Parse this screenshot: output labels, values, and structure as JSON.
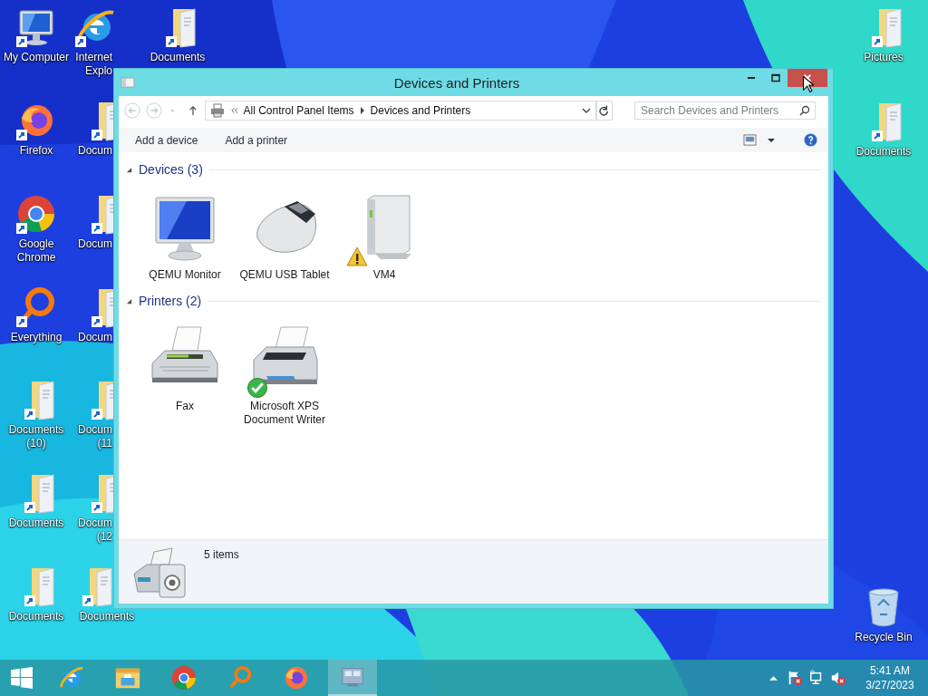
{
  "desktop": {
    "left_columns": [
      {
        "items": [
          {
            "label": "My Computer",
            "kind": "computer"
          },
          {
            "label": "Firefox",
            "kind": "firefox"
          },
          {
            "label": "Google Chrome",
            "kind": "chrome"
          },
          {
            "label": "Everything",
            "kind": "everything"
          },
          {
            "label": "Documents (10)",
            "kind": "folder"
          },
          {
            "label": "Documents",
            "kind": "folder"
          },
          {
            "label": "Documents",
            "kind": "folder"
          }
        ]
      },
      {
        "items": [
          {
            "label": "Internet Explo",
            "kind": "ie",
            "cut": true
          },
          {
            "label": "Docum",
            "kind": "folder",
            "cut": true
          },
          {
            "label": "Docum",
            "kind": "folder",
            "cut": true
          },
          {
            "label": "Docum",
            "kind": "folder",
            "cut": true
          },
          {
            "label": "Docum (11",
            "kind": "folder",
            "cut": true
          },
          {
            "label": "Docum (12",
            "kind": "folder",
            "cut": true
          },
          {
            "label": "Documents",
            "kind": "folder",
            "cut": false
          }
        ]
      },
      {
        "items": [
          {
            "label": "Documents",
            "kind": "folder"
          }
        ]
      }
    ],
    "right_column": {
      "items": [
        {
          "label": "Pictures",
          "kind": "folder"
        },
        {
          "label": "Documents",
          "kind": "folder"
        },
        {
          "label": "Recycle Bin",
          "kind": "recycle"
        }
      ]
    }
  },
  "window": {
    "title": "Devices and Printers",
    "address": {
      "crumbs": [
        "All Control Panel Items",
        "Devices and Printers"
      ]
    },
    "search": {
      "placeholder": "Search Devices and Printers"
    },
    "commands": [
      "Add a device",
      "Add a printer"
    ],
    "groups": [
      {
        "title": "Devices (3)",
        "expanded": true,
        "items": [
          {
            "label": "QEMU Monitor",
            "kind": "monitor",
            "warning": false,
            "default": false
          },
          {
            "label": "QEMU USB Tablet",
            "kind": "mouse",
            "warning": false,
            "default": false
          },
          {
            "label": "VM4",
            "kind": "drive",
            "warning": true,
            "default": false
          }
        ]
      },
      {
        "title": "Printers (2)",
        "expanded": true,
        "items": [
          {
            "label": "Fax",
            "kind": "fax",
            "warning": false,
            "default": false
          },
          {
            "label": "Microsoft XPS Document Writer",
            "kind": "printer",
            "warning": false,
            "default": true
          }
        ]
      }
    ],
    "details": {
      "text": "5 items"
    }
  },
  "taskbar": {
    "items": [
      {
        "kind": "ie",
        "selected": false
      },
      {
        "kind": "explorer",
        "selected": false
      },
      {
        "kind": "chrome",
        "selected": false
      },
      {
        "kind": "everything",
        "selected": false
      },
      {
        "kind": "firefox",
        "selected": false
      },
      {
        "kind": "control-panel",
        "selected": true
      }
    ],
    "tray": [
      {
        "kind": "flag",
        "error": true
      },
      {
        "kind": "network",
        "error": false
      },
      {
        "kind": "volume",
        "error": true
      }
    ],
    "time": "5:41 AM",
    "date": "3/27/2023"
  }
}
